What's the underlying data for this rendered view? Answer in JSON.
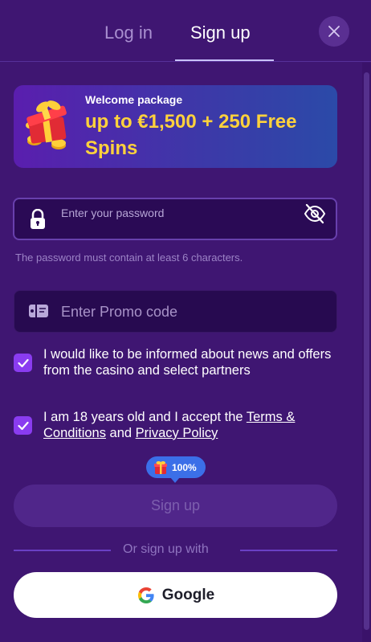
{
  "tabs": {
    "login": "Log in",
    "signup": "Sign up",
    "active": "signup"
  },
  "banner": {
    "kicker": "Welcome package",
    "title": "up to €1,500 + 250 Free Spins"
  },
  "password": {
    "placeholder": "Enter your password",
    "value": "",
    "hint": "The password must contain at least 6 characters."
  },
  "promo": {
    "placeholder": "Enter Promo code",
    "value": ""
  },
  "consents": {
    "news": {
      "checked": true,
      "text": "I would like to be informed about news and offers from the casino and select partners"
    },
    "age": {
      "checked": true,
      "prefix": "I am 18 years old and I accept the ",
      "terms_link": "Terms & Conditions",
      "middle": " and ",
      "privacy_link": "Privacy Policy"
    }
  },
  "bonus_badge": {
    "text": "100%"
  },
  "signup_button": {
    "label": "Sign up",
    "enabled": false
  },
  "divider": {
    "text": "Or sign up with"
  },
  "google_button": {
    "label": "Google"
  },
  "icons": {
    "close": "close-icon",
    "gift": "gift-icon",
    "lock": "lock-icon",
    "eye": "eye-off-icon",
    "promo": "ticket-icon",
    "google": "google-icon"
  },
  "colors": {
    "background": "#3f1672",
    "banner_title": "#ffd23c",
    "checkbox": "#8a3cf0",
    "badge": "#3b6fe8"
  }
}
